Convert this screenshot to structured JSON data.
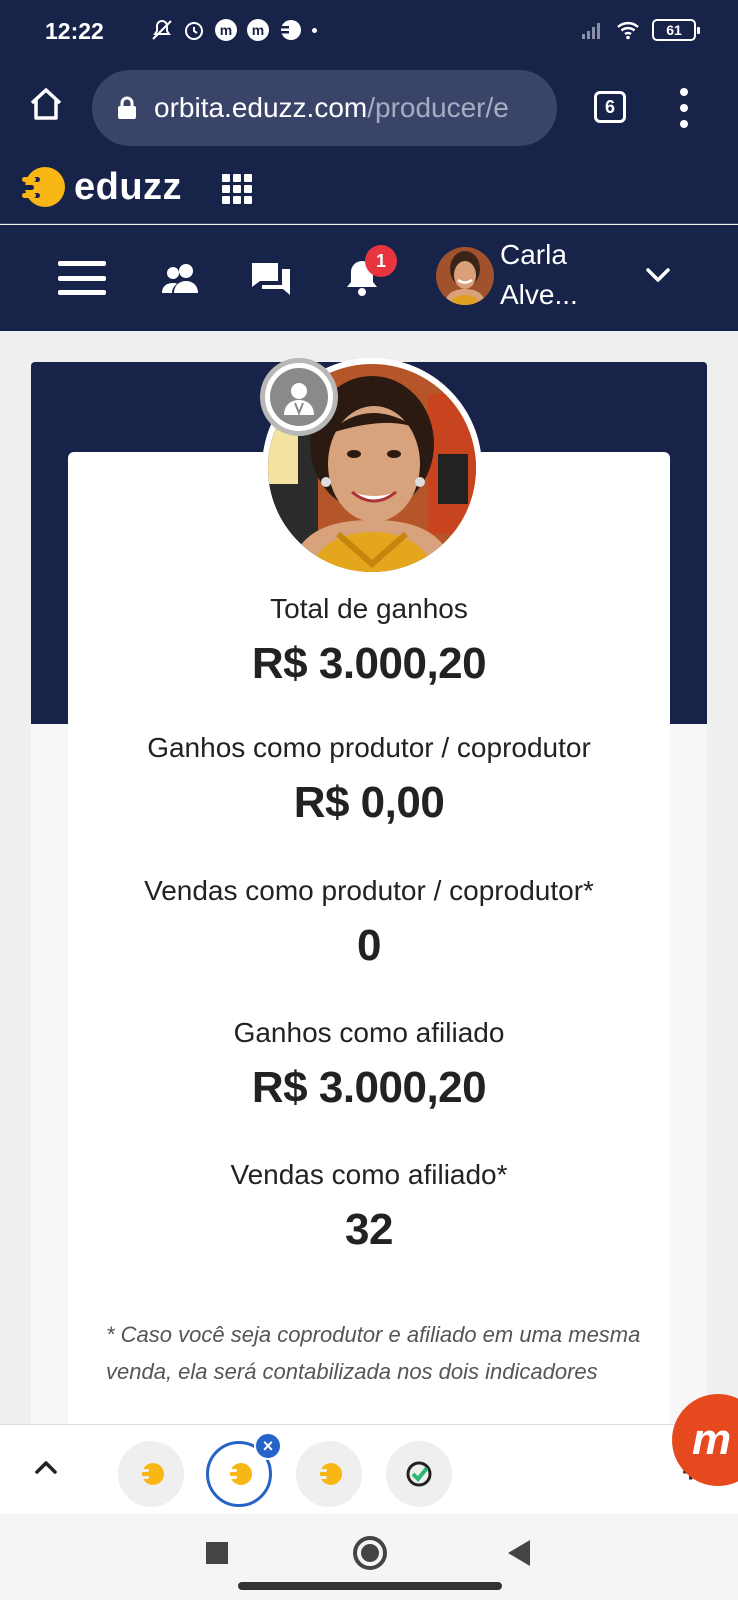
{
  "status_bar": {
    "time": "12:22",
    "battery": "61",
    "icons": [
      "notifications-off-icon",
      "alarm-icon",
      "app-m-icon",
      "app-m-icon",
      "eduzz-icon",
      "dot-icon",
      "signal-icon",
      "wifi-icon",
      "battery-icon"
    ]
  },
  "browser": {
    "url_host": "orbita.eduzz.com",
    "url_path": "/producer/e",
    "tab_count": "6"
  },
  "header": {
    "logo_text": "eduzz",
    "brand_color": "#f9b716",
    "nav_bg": "#18234a"
  },
  "nav": {
    "notification_count": "1",
    "user_first": "Carla",
    "user_last": "Alve..."
  },
  "stats": [
    {
      "label": "Total de ganhos",
      "value": "R$ 3.000,20"
    },
    {
      "label": "Ganhos como produtor / coprodutor",
      "value": "R$ 0,00"
    },
    {
      "label": "Vendas como produtor / coprodutor*",
      "value": "0"
    },
    {
      "label": "Ganhos como afiliado",
      "value": "R$ 3.000,20"
    },
    {
      "label": "Vendas como afiliado*",
      "value": "32"
    }
  ],
  "footnote": "* Caso você seja coprodutor e afiliado em uma mesma venda, ela será contabilizada nos dois indicadores",
  "bubbles": {
    "close_symbol": "×",
    "floating_letter": "m",
    "plus": "+"
  }
}
